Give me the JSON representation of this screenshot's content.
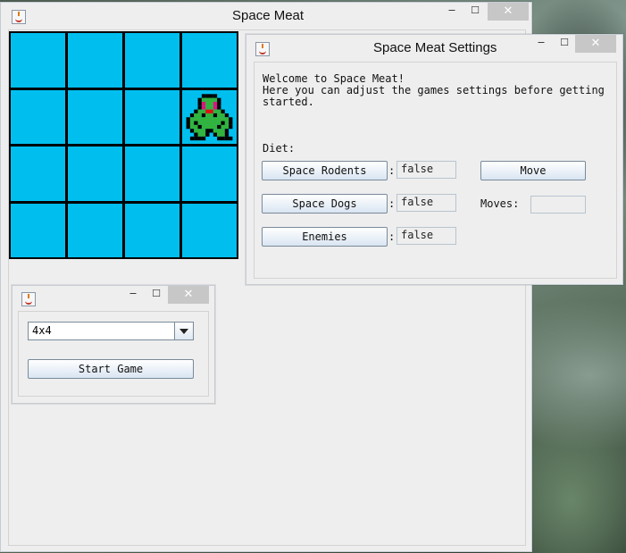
{
  "main_window": {
    "title": "Space Meat",
    "grid_size": 4,
    "player_cell": {
      "row": 2,
      "col": 4
    }
  },
  "settings_window": {
    "title": "Space Meat Settings",
    "welcome_lines": [
      "Welcome to Space Meat!",
      "Here you can adjust the games settings before getting",
      "started."
    ],
    "diet_label": "Diet:",
    "diet_options": [
      {
        "label": "Space Rodents",
        "value": "false"
      },
      {
        "label": "Space Dogs",
        "value": "false"
      },
      {
        "label": "Enemies",
        "value": "false"
      }
    ],
    "separator": ":",
    "move_button": "Move",
    "moves_label": "Moves:",
    "moves_value": ""
  },
  "launcher_window": {
    "selected_size": "4x4",
    "start_button": "Start Game"
  },
  "window_controls": {
    "minimize": "‒",
    "maximize": "☐",
    "close": "✕"
  },
  "icons": {
    "app": "java-coffee-icon",
    "combo": "chevron-down-icon"
  },
  "colors": {
    "cell": "#00bfef",
    "grid_line": "#000000",
    "sprite_green": "#33b33a",
    "sprite_eye": "#e0127a",
    "sprite_mouth": "#e01010"
  }
}
